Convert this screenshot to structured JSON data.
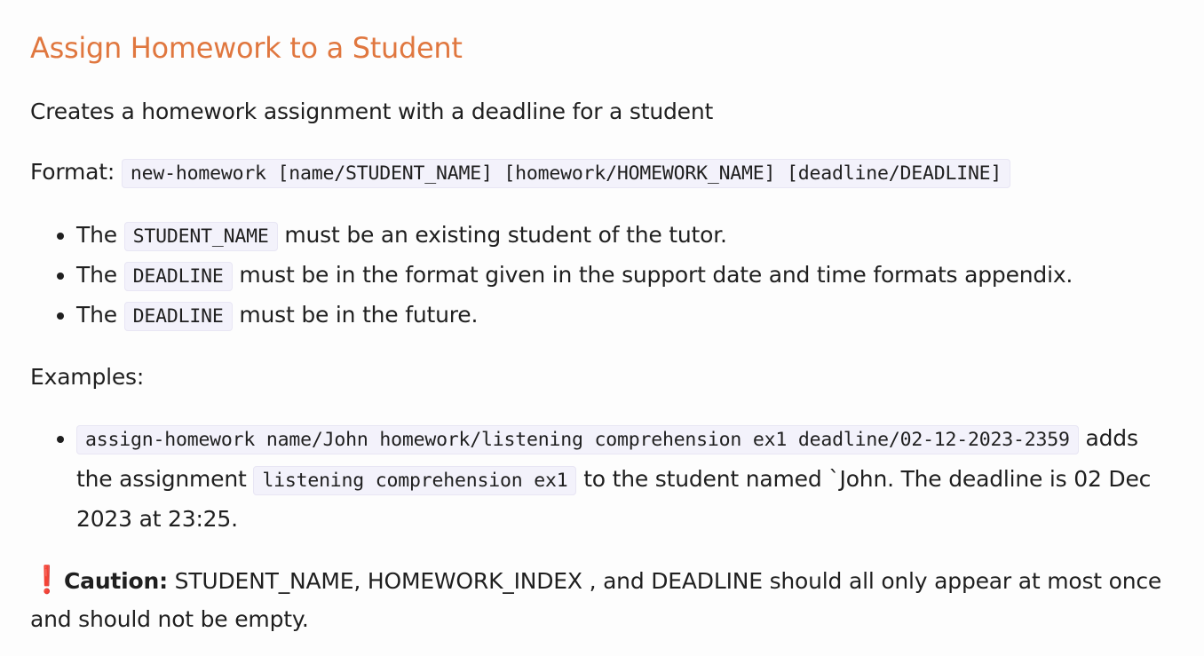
{
  "heading": "Assign Homework to a Student",
  "description": "Creates a homework assignment with a deadline for a student",
  "format": {
    "label": "Format:",
    "code": "new-homework [name/STUDENT_NAME] [homework/HOMEWORK_NAME] [deadline/DEADLINE]"
  },
  "rules": [
    {
      "prefix": "The",
      "code": "STUDENT_NAME",
      "text": "must be an existing student of the tutor."
    },
    {
      "prefix": "The",
      "code": "DEADLINE",
      "text": "must be in the format given in the support date and time formats appendix."
    },
    {
      "prefix": "The",
      "code": "DEADLINE",
      "text": "must be in the future."
    }
  ],
  "examples_label": "Examples:",
  "examples": [
    {
      "command": "assign-homework name/John homework/listening comprehension ex1 deadline/02-12-2023-2359",
      "text_1": "adds the assignment",
      "assignment_code": "listening comprehension ex1",
      "text_2": "to the student named `John. The deadline is 02 Dec 2023 at 23:25."
    }
  ],
  "caution": {
    "icon": "❗",
    "label": "Caution:",
    "text": "STUDENT_NAME, HOMEWORK_INDEX , and DEADLINE should all only appear at most once and should not be empty."
  },
  "colors": {
    "heading": "#e0773f",
    "code_background": "#f3f2fb",
    "caution_icon": "#d9232a"
  }
}
